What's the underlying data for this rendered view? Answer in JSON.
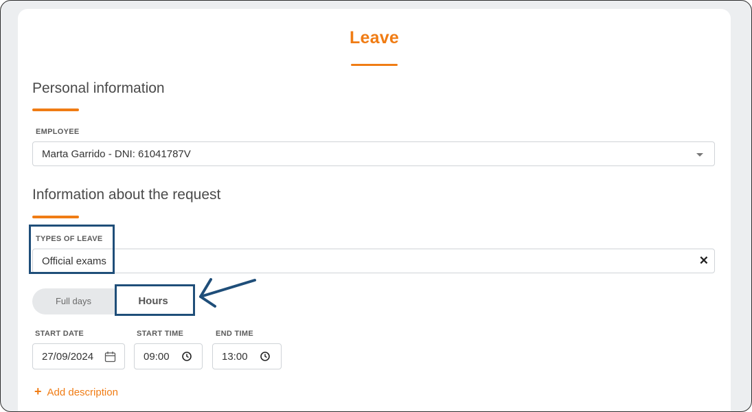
{
  "page": {
    "title": "Leave"
  },
  "personal_section": {
    "title": "Personal information",
    "employee_label": "EMPLOYEE",
    "employee_value": "Marta Garrido - DNI: 61041787V"
  },
  "request_section": {
    "title": "Information about the request",
    "types_label": "TYPES OF LEAVE",
    "types_value": "Official exams"
  },
  "duration_toggle": {
    "options": [
      "Full days",
      "Hours"
    ],
    "selected": "Hours"
  },
  "dates": {
    "start_date_label": "START DATE",
    "start_date_value": "27/09/2024",
    "start_time_label": "START TIME",
    "start_time_value": "09:00",
    "end_time_label": "END TIME",
    "end_time_value": "13:00"
  },
  "actions": {
    "add_description": "Add description"
  },
  "icons": {
    "employee_dropdown": "chevron-down-icon",
    "clear_type": "close-icon",
    "start_date": "calendar-icon",
    "start_time": "clock-icon",
    "end_time": "clock-icon",
    "add": "plus-icon"
  },
  "colors": {
    "accent": "#f07c14",
    "annotation": "#1f4e79",
    "background": "#eceef0"
  }
}
